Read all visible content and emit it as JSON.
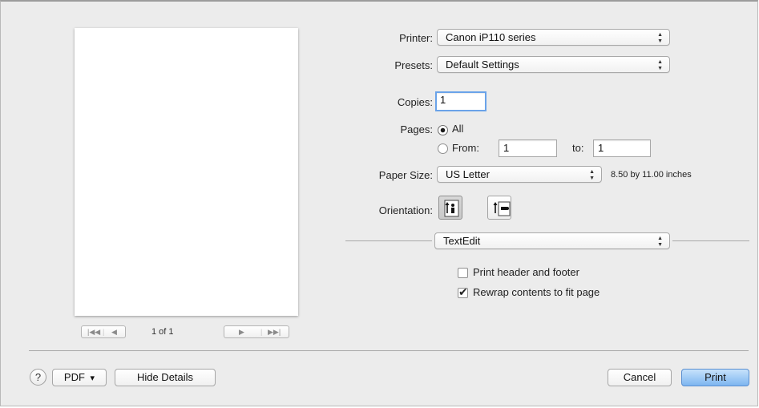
{
  "preview": {
    "page_indicator": "1 of 1"
  },
  "printer": {
    "label": "Printer:",
    "value": "Canon iP110 series"
  },
  "presets": {
    "label": "Presets:",
    "value": "Default Settings"
  },
  "copies": {
    "label": "Copies:",
    "value": "1"
  },
  "pages": {
    "label": "Pages:",
    "all_label": "All",
    "from_label": "From:",
    "from_value": "1",
    "to_label": "to:",
    "to_value": "1",
    "selected": "All"
  },
  "paper_size": {
    "label": "Paper Size:",
    "value": "US Letter",
    "dimensions": "8.50 by 11.00 inches"
  },
  "orientation": {
    "label": "Orientation:",
    "selected": "portrait"
  },
  "section": {
    "value": "TextEdit"
  },
  "options": {
    "print_header_footer": {
      "label": "Print header and footer",
      "checked": false
    },
    "rewrap_contents": {
      "label": "Rewrap contents to fit page",
      "checked": true
    }
  },
  "footer": {
    "help_label": "?",
    "pdf_label": "PDF",
    "hide_details_label": "Hide Details",
    "cancel_label": "Cancel",
    "print_label": "Print"
  },
  "icons": {
    "popup_arrows": "↕",
    "pager_first": "⏮",
    "pager_prev": "◀",
    "pager_next": "▶",
    "pager_last": "⏭",
    "checkmark": "✔",
    "pdf_menu": "▾"
  },
  "colors": {
    "default_button": "#7db5f0",
    "focus_ring": "#6aa3e9",
    "dialog_bg": "#ececec"
  }
}
